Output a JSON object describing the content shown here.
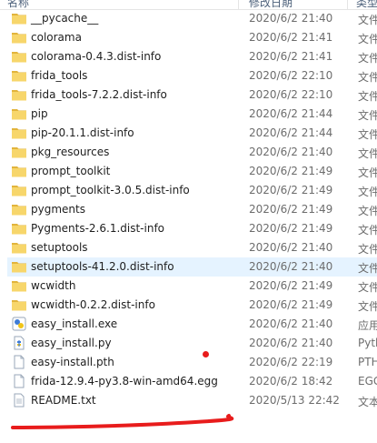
{
  "header": {
    "name": "名称",
    "date": "修改日期",
    "type": "类型"
  },
  "files": [
    {
      "name": "__pycache__",
      "date": "2020/6/2 21:40",
      "type": "文件",
      "icon": "folder-icon"
    },
    {
      "name": "colorama",
      "date": "2020/6/2 21:41",
      "type": "文件",
      "icon": "folder-icon"
    },
    {
      "name": "colorama-0.4.3.dist-info",
      "date": "2020/6/2 21:41",
      "type": "文件",
      "icon": "folder-icon"
    },
    {
      "name": "frida_tools",
      "date": "2020/6/2 22:10",
      "type": "文件",
      "icon": "folder-icon"
    },
    {
      "name": "frida_tools-7.2.2.dist-info",
      "date": "2020/6/2 22:10",
      "type": "文件",
      "icon": "folder-icon"
    },
    {
      "name": "pip",
      "date": "2020/6/2 21:44",
      "type": "文件",
      "icon": "folder-icon"
    },
    {
      "name": "pip-20.1.1.dist-info",
      "date": "2020/6/2 21:44",
      "type": "文件",
      "icon": "folder-icon"
    },
    {
      "name": "pkg_resources",
      "date": "2020/6/2 21:40",
      "type": "文件",
      "icon": "folder-icon"
    },
    {
      "name": "prompt_toolkit",
      "date": "2020/6/2 21:49",
      "type": "文件",
      "icon": "folder-icon"
    },
    {
      "name": "prompt_toolkit-3.0.5.dist-info",
      "date": "2020/6/2 21:49",
      "type": "文件",
      "icon": "folder-icon"
    },
    {
      "name": "pygments",
      "date": "2020/6/2 21:49",
      "type": "文件",
      "icon": "folder-icon"
    },
    {
      "name": "Pygments-2.6.1.dist-info",
      "date": "2020/6/2 21:49",
      "type": "文件",
      "icon": "folder-icon"
    },
    {
      "name": "setuptools",
      "date": "2020/6/2 21:40",
      "type": "文件",
      "icon": "folder-icon"
    },
    {
      "name": "setuptools-41.2.0.dist-info",
      "date": "2020/6/2 21:40",
      "type": "文件",
      "icon": "folder-icon",
      "selected": true
    },
    {
      "name": "wcwidth",
      "date": "2020/6/2 21:49",
      "type": "文件",
      "icon": "folder-icon"
    },
    {
      "name": "wcwidth-0.2.2.dist-info",
      "date": "2020/6/2 21:49",
      "type": "文件",
      "icon": "folder-icon"
    },
    {
      "name": "easy_install.exe",
      "date": "2020/6/2 21:40",
      "type": "应用",
      "icon": "exe-icon"
    },
    {
      "name": "easy_install.py",
      "date": "2020/6/2 21:40",
      "type": "Pyth",
      "icon": "python-file-icon"
    },
    {
      "name": "easy-install.pth",
      "date": "2020/6/2 22:19",
      "type": "PTH",
      "icon": "file-icon"
    },
    {
      "name": "frida-12.9.4-py3.8-win-amd64.egg",
      "date": "2020/6/2 18:42",
      "type": "EGG",
      "icon": "file-icon"
    },
    {
      "name": "README.txt",
      "date": "2020/5/13 22:42",
      "type": "文本",
      "icon": "text-file-icon"
    }
  ],
  "colors": {
    "folder": "#f7d66b",
    "folder_dark": "#e2b43c",
    "selection": "#e5f3ff",
    "annotation": "#e81c1c"
  }
}
